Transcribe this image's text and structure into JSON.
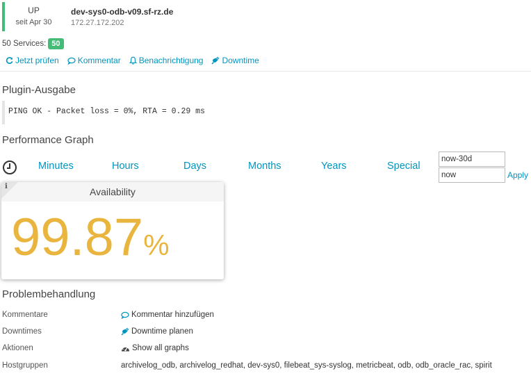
{
  "host": {
    "state": "UP",
    "since": "seit Apr 30",
    "name": "dev-sys0-odb-v09.sf-rz.de",
    "address": "172.27.172.202",
    "services_label": "50 Services:",
    "services_count": "50",
    "state_color": "#44bb77"
  },
  "actions": [
    {
      "label": "Jetzt prüfen",
      "icon": "refresh-icon"
    },
    {
      "label": "Kommentar",
      "icon": "comment-icon"
    },
    {
      "label": "Benachrichtigung",
      "icon": "bell-icon"
    },
    {
      "label": "Downtime",
      "icon": "plug-icon"
    }
  ],
  "plugin": {
    "title": "Plugin-Ausgabe",
    "output": "PING OK - Packet loss = 0%, RTA = 0.29 ms"
  },
  "perf": {
    "title": "Performance Graph",
    "ranges": [
      "Minutes",
      "Hours",
      "Days",
      "Months",
      "Years",
      "Special"
    ],
    "from_value": "now-30d",
    "to_value": "now",
    "apply_label": "Apply"
  },
  "availability": {
    "title": "Availability",
    "value": "99.87",
    "unit": "%",
    "color": "#e9b53f"
  },
  "problem": {
    "title": "Problembehandlung",
    "rows": [
      {
        "label": "Kommentare",
        "value": "Kommentar hinzufügen",
        "icon": "comment-icon"
      },
      {
        "label": "Downtimes",
        "value": "Downtime planen",
        "icon": "plug-icon"
      },
      {
        "label": "Aktionen",
        "value": "Show all graphs",
        "icon": "dashboard-icon"
      },
      {
        "label": "Hostgruppen",
        "value": ""
      }
    ],
    "hostgroups": [
      "archivelog_odb",
      "archivelog_redhat",
      "dev-sys0",
      "filebeat_sys-syslog",
      "metricbeat",
      "odb",
      "odb_oracle_rac",
      "spirit"
    ]
  },
  "accent_color": "#0095bf"
}
